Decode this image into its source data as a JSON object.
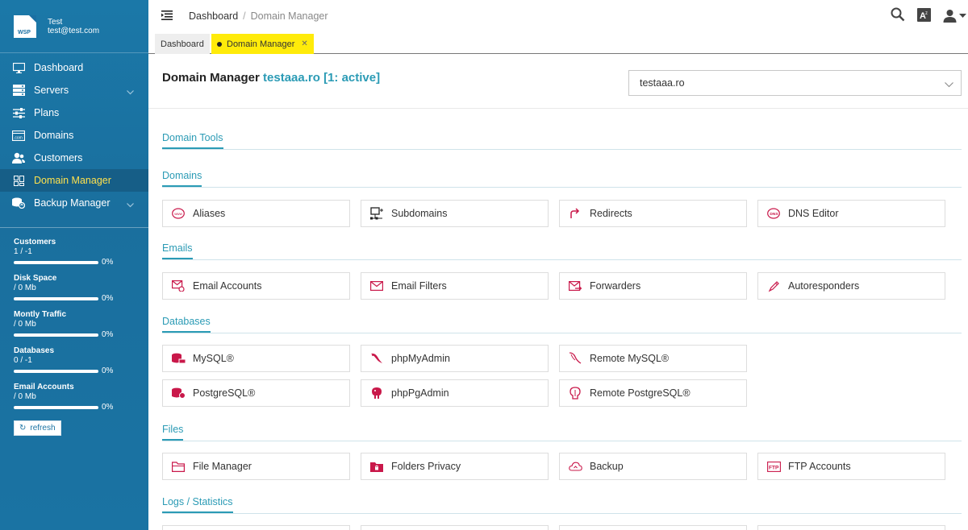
{
  "user": {
    "name": "Test",
    "email": "test@test.com",
    "logo_text": "WSP"
  },
  "nav": [
    {
      "label": "Dashboard",
      "icon": "monitor-icon",
      "active": false,
      "chevron": false
    },
    {
      "label": "Servers",
      "icon": "servers-icon",
      "active": false,
      "chevron": true
    },
    {
      "label": "Plans",
      "icon": "sliders-icon",
      "active": false,
      "chevron": false
    },
    {
      "label": "Domains",
      "icon": "domains-icon",
      "active": false,
      "chevron": false
    },
    {
      "label": "Customers",
      "icon": "customers-icon",
      "active": false,
      "chevron": false
    },
    {
      "label": "Domain Manager",
      "icon": "grid-icon",
      "active": true,
      "chevron": false
    },
    {
      "label": "Backup Manager",
      "icon": "backup-icon",
      "active": false,
      "chevron": true
    }
  ],
  "stats": [
    {
      "title": "Customers",
      "value": "1 / -1",
      "pct": "0%",
      "fill": 0
    },
    {
      "title": "Disk Space",
      "value": "/ 0 Mb",
      "pct": "0%",
      "fill": 0
    },
    {
      "title": "Montly Traffic",
      "value": "/ 0 Mb",
      "pct": "0%",
      "fill": 0
    },
    {
      "title": "Databases",
      "value": "0 / -1",
      "pct": "0%",
      "fill": 0
    },
    {
      "title": "Email Accounts",
      "value": "/ 0 Mb",
      "pct": "0%",
      "fill": 0
    }
  ],
  "refresh_label": "refresh",
  "breadcrumb": {
    "root": "Dashboard",
    "current": "Domain Manager"
  },
  "tabs": [
    {
      "label": "Dashboard"
    },
    {
      "label": "Domain Manager"
    }
  ],
  "header": {
    "title": "Domain Manager",
    "domain": "testaaa.ro [1: active]"
  },
  "domain_select": {
    "value": "testaaa.ro"
  },
  "sections": {
    "tools": "Domain Tools",
    "domains": "Domains",
    "emails": "Emails",
    "databases": "Databases",
    "files": "Files",
    "logs": "Logs / Statistics"
  },
  "cards": {
    "domains": [
      "Aliases",
      "Subdomains",
      "Redirects",
      "DNS Editor"
    ],
    "emails": [
      "Email Accounts",
      "Email Filters",
      "Forwarders",
      "Autoresponders"
    ],
    "databases": [
      "MySQL®",
      "phpMyAdmin",
      "Remote MySQL®",
      "PostgreSQL®",
      "phpPgAdmin",
      "Remote PostgreSQL®"
    ],
    "files": [
      "File Manager",
      "Folders Privacy",
      "Backup",
      "FTP Accounts"
    ]
  },
  "colors": {
    "sidebar": "#1a73a3",
    "accent": "#2b9bb5",
    "active_nav_text": "#ffe14d",
    "active_tab": "#ffeb0a",
    "icon_red": "#c9184a"
  }
}
